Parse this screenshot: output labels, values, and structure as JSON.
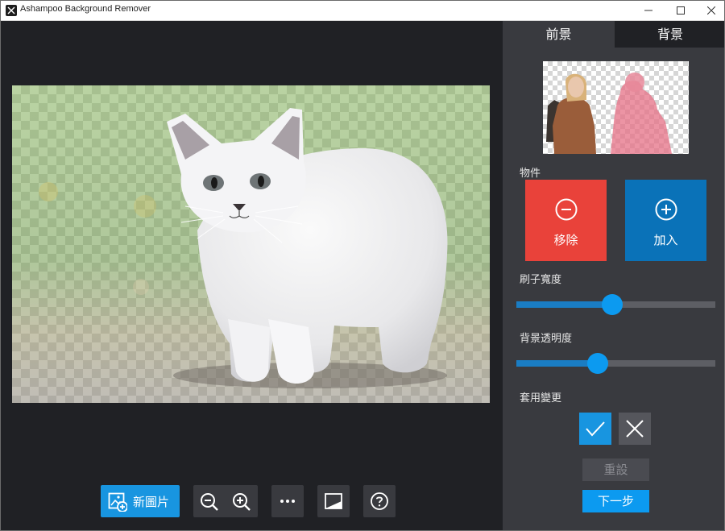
{
  "window": {
    "title": "Ashampoo Background Remover"
  },
  "tabs": {
    "foreground": "前景",
    "background": "背景"
  },
  "objects": {
    "label": "物件",
    "remove_label": "移除",
    "add_label": "加入"
  },
  "brush": {
    "label": "刷子寬度",
    "value": 0.48
  },
  "bg_opacity": {
    "label": "背景透明度",
    "value": 0.41
  },
  "apply": {
    "label": "套用變更"
  },
  "actions": {
    "reset_label": "重設",
    "next_label": "下一步"
  },
  "toolbar": {
    "new_image_label": "新圖片"
  },
  "colors": {
    "accent": "#0c9af0",
    "remove": "#e9423a",
    "add": "#0a72b8",
    "panel": "#393a3f",
    "canvas": "#202125"
  },
  "icons": [
    "app-icon",
    "minimize-icon",
    "maximize-icon",
    "close-icon",
    "new-image-icon",
    "zoom-out-icon",
    "zoom-in-icon",
    "more-icon",
    "compare-icon",
    "help-icon",
    "minus-circle-icon",
    "plus-circle-icon",
    "check-icon",
    "cancel-icon"
  ]
}
